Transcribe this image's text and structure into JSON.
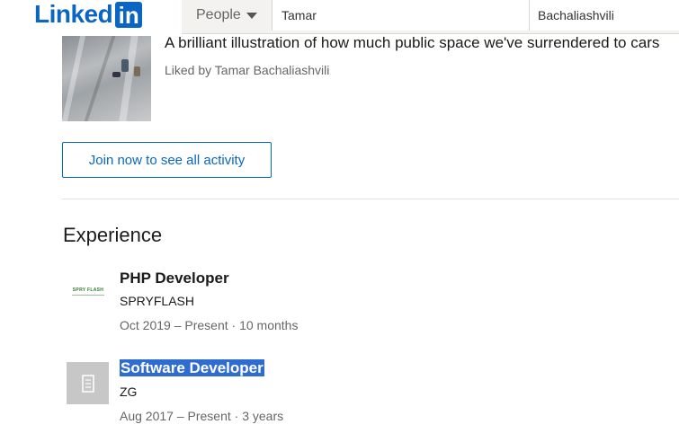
{
  "header": {
    "logo_text": "Linked",
    "logo_in": "in",
    "search_scope": "People",
    "first_name_value": "Tamar",
    "last_name_value": "Bachaliashvili"
  },
  "activity": {
    "post_title": "A brilliant illustration of how much public space we've surrendered to cars",
    "liked_by": "Liked by Tamar Bachaliashvili",
    "join_button": "Join now to see all activity"
  },
  "experience": {
    "heading": "Experience",
    "spryflash_logo_text": "SPRY FLASH",
    "items": [
      {
        "title": "PHP Developer",
        "company": "SPRYFLASH",
        "dates": "Oct 2019 – Present · 10 months"
      },
      {
        "title": "Software Developer",
        "company": "ZG",
        "dates": "Aug 2017 – Present · 3 years"
      }
    ]
  },
  "colors": {
    "brand": "#0a66c2",
    "selection": "#2e6cd1",
    "muted_text": "#666666"
  },
  "icons": {
    "company_placeholder": "building-icon",
    "scope_dropdown": "caret-down-icon"
  }
}
